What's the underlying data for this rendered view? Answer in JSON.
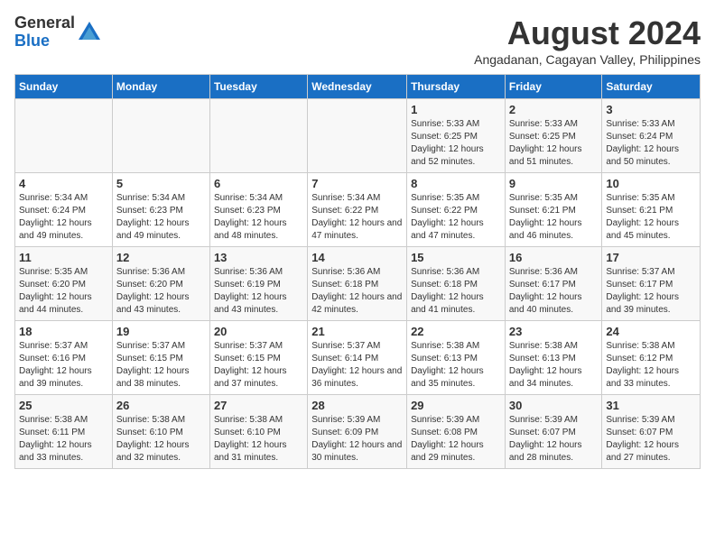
{
  "logo": {
    "general": "General",
    "blue": "Blue"
  },
  "title": {
    "month_year": "August 2024",
    "location": "Angadanan, Cagayan Valley, Philippines"
  },
  "days": [
    "Sunday",
    "Monday",
    "Tuesday",
    "Wednesday",
    "Thursday",
    "Friday",
    "Saturday"
  ],
  "weeks": [
    [
      {
        "date": "",
        "sunrise": "",
        "sunset": "",
        "daylight": ""
      },
      {
        "date": "",
        "sunrise": "",
        "sunset": "",
        "daylight": ""
      },
      {
        "date": "",
        "sunrise": "",
        "sunset": "",
        "daylight": ""
      },
      {
        "date": "",
        "sunrise": "",
        "sunset": "",
        "daylight": ""
      },
      {
        "date": "1",
        "sunrise": "Sunrise: 5:33 AM",
        "sunset": "Sunset: 6:25 PM",
        "daylight": "Daylight: 12 hours and 52 minutes."
      },
      {
        "date": "2",
        "sunrise": "Sunrise: 5:33 AM",
        "sunset": "Sunset: 6:25 PM",
        "daylight": "Daylight: 12 hours and 51 minutes."
      },
      {
        "date": "3",
        "sunrise": "Sunrise: 5:33 AM",
        "sunset": "Sunset: 6:24 PM",
        "daylight": "Daylight: 12 hours and 50 minutes."
      }
    ],
    [
      {
        "date": "4",
        "sunrise": "Sunrise: 5:34 AM",
        "sunset": "Sunset: 6:24 PM",
        "daylight": "Daylight: 12 hours and 49 minutes."
      },
      {
        "date": "5",
        "sunrise": "Sunrise: 5:34 AM",
        "sunset": "Sunset: 6:23 PM",
        "daylight": "Daylight: 12 hours and 49 minutes."
      },
      {
        "date": "6",
        "sunrise": "Sunrise: 5:34 AM",
        "sunset": "Sunset: 6:23 PM",
        "daylight": "Daylight: 12 hours and 48 minutes."
      },
      {
        "date": "7",
        "sunrise": "Sunrise: 5:34 AM",
        "sunset": "Sunset: 6:22 PM",
        "daylight": "Daylight: 12 hours and 47 minutes."
      },
      {
        "date": "8",
        "sunrise": "Sunrise: 5:35 AM",
        "sunset": "Sunset: 6:22 PM",
        "daylight": "Daylight: 12 hours and 47 minutes."
      },
      {
        "date": "9",
        "sunrise": "Sunrise: 5:35 AM",
        "sunset": "Sunset: 6:21 PM",
        "daylight": "Daylight: 12 hours and 46 minutes."
      },
      {
        "date": "10",
        "sunrise": "Sunrise: 5:35 AM",
        "sunset": "Sunset: 6:21 PM",
        "daylight": "Daylight: 12 hours and 45 minutes."
      }
    ],
    [
      {
        "date": "11",
        "sunrise": "Sunrise: 5:35 AM",
        "sunset": "Sunset: 6:20 PM",
        "daylight": "Daylight: 12 hours and 44 minutes."
      },
      {
        "date": "12",
        "sunrise": "Sunrise: 5:36 AM",
        "sunset": "Sunset: 6:20 PM",
        "daylight": "Daylight: 12 hours and 43 minutes."
      },
      {
        "date": "13",
        "sunrise": "Sunrise: 5:36 AM",
        "sunset": "Sunset: 6:19 PM",
        "daylight": "Daylight: 12 hours and 43 minutes."
      },
      {
        "date": "14",
        "sunrise": "Sunrise: 5:36 AM",
        "sunset": "Sunset: 6:18 PM",
        "daylight": "Daylight: 12 hours and 42 minutes."
      },
      {
        "date": "15",
        "sunrise": "Sunrise: 5:36 AM",
        "sunset": "Sunset: 6:18 PM",
        "daylight": "Daylight: 12 hours and 41 minutes."
      },
      {
        "date": "16",
        "sunrise": "Sunrise: 5:36 AM",
        "sunset": "Sunset: 6:17 PM",
        "daylight": "Daylight: 12 hours and 40 minutes."
      },
      {
        "date": "17",
        "sunrise": "Sunrise: 5:37 AM",
        "sunset": "Sunset: 6:17 PM",
        "daylight": "Daylight: 12 hours and 39 minutes."
      }
    ],
    [
      {
        "date": "18",
        "sunrise": "Sunrise: 5:37 AM",
        "sunset": "Sunset: 6:16 PM",
        "daylight": "Daylight: 12 hours and 39 minutes."
      },
      {
        "date": "19",
        "sunrise": "Sunrise: 5:37 AM",
        "sunset": "Sunset: 6:15 PM",
        "daylight": "Daylight: 12 hours and 38 minutes."
      },
      {
        "date": "20",
        "sunrise": "Sunrise: 5:37 AM",
        "sunset": "Sunset: 6:15 PM",
        "daylight": "Daylight: 12 hours and 37 minutes."
      },
      {
        "date": "21",
        "sunrise": "Sunrise: 5:37 AM",
        "sunset": "Sunset: 6:14 PM",
        "daylight": "Daylight: 12 hours and 36 minutes."
      },
      {
        "date": "22",
        "sunrise": "Sunrise: 5:38 AM",
        "sunset": "Sunset: 6:13 PM",
        "daylight": "Daylight: 12 hours and 35 minutes."
      },
      {
        "date": "23",
        "sunrise": "Sunrise: 5:38 AM",
        "sunset": "Sunset: 6:13 PM",
        "daylight": "Daylight: 12 hours and 34 minutes."
      },
      {
        "date": "24",
        "sunrise": "Sunrise: 5:38 AM",
        "sunset": "Sunset: 6:12 PM",
        "daylight": "Daylight: 12 hours and 33 minutes."
      }
    ],
    [
      {
        "date": "25",
        "sunrise": "Sunrise: 5:38 AM",
        "sunset": "Sunset: 6:11 PM",
        "daylight": "Daylight: 12 hours and 33 minutes."
      },
      {
        "date": "26",
        "sunrise": "Sunrise: 5:38 AM",
        "sunset": "Sunset: 6:10 PM",
        "daylight": "Daylight: 12 hours and 32 minutes."
      },
      {
        "date": "27",
        "sunrise": "Sunrise: 5:38 AM",
        "sunset": "Sunset: 6:10 PM",
        "daylight": "Daylight: 12 hours and 31 minutes."
      },
      {
        "date": "28",
        "sunrise": "Sunrise: 5:39 AM",
        "sunset": "Sunset: 6:09 PM",
        "daylight": "Daylight: 12 hours and 30 minutes."
      },
      {
        "date": "29",
        "sunrise": "Sunrise: 5:39 AM",
        "sunset": "Sunset: 6:08 PM",
        "daylight": "Daylight: 12 hours and 29 minutes."
      },
      {
        "date": "30",
        "sunrise": "Sunrise: 5:39 AM",
        "sunset": "Sunset: 6:07 PM",
        "daylight": "Daylight: 12 hours and 28 minutes."
      },
      {
        "date": "31",
        "sunrise": "Sunrise: 5:39 AM",
        "sunset": "Sunset: 6:07 PM",
        "daylight": "Daylight: 12 hours and 27 minutes."
      }
    ]
  ]
}
